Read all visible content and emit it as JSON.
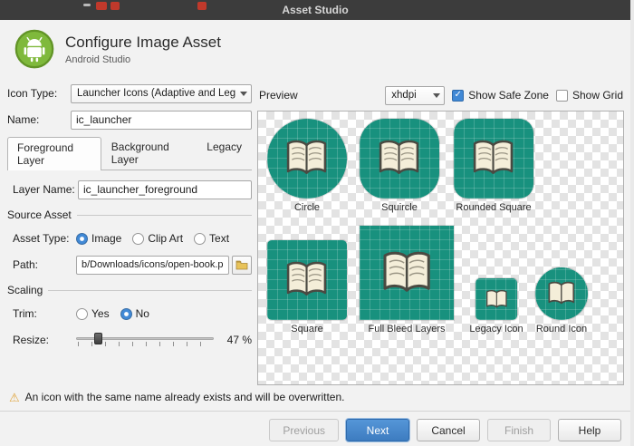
{
  "titlebar": {
    "title": "Asset Studio"
  },
  "header": {
    "title": "Configure Image Asset",
    "subtitle": "Android Studio"
  },
  "form": {
    "icon_type_label": "Icon Type:",
    "icon_type_value": "Launcher Icons (Adaptive and Legacy)",
    "name_label": "Name:",
    "name_value": "ic_launcher",
    "tabs": [
      {
        "label": "Foreground Layer",
        "selected": true
      },
      {
        "label": "Background Layer",
        "selected": false
      },
      {
        "label": "Legacy",
        "selected": false
      }
    ],
    "layer_name_label": "Layer Name:",
    "layer_name_value": "ic_launcher_foreground",
    "source_asset_section": "Source Asset",
    "asset_type_label": "Asset Type:",
    "asset_type_options": [
      "Image",
      "Clip Art",
      "Text"
    ],
    "asset_type_selected": "Image",
    "path_label": "Path:",
    "path_value": "b/Downloads/icons/open-book.png",
    "scaling_section": "Scaling",
    "trim_label": "Trim:",
    "trim_options": [
      "Yes",
      "No"
    ],
    "trim_selected": "No",
    "resize_label": "Resize:",
    "resize_value": "47 %"
  },
  "preview": {
    "label": "Preview",
    "density_value": "xhdpi",
    "safe_zone_label": "Show Safe Zone",
    "safe_zone_checked": true,
    "grid_label": "Show Grid",
    "grid_checked": false,
    "icons": [
      {
        "label": "Circle"
      },
      {
        "label": "Squircle"
      },
      {
        "label": "Rounded Square"
      },
      {
        "label": "Square"
      },
      {
        "label": "Full Bleed Layers"
      },
      {
        "label": "Legacy Icon"
      },
      {
        "label": "Round Icon"
      }
    ],
    "check_glyph": "✓"
  },
  "footer": {
    "warning_icon": "⚠",
    "warning": "An icon with the same name already exists and will be overwritten.",
    "buttons": [
      {
        "label": "Previous",
        "state": "disabled"
      },
      {
        "label": "Next",
        "state": "primary"
      },
      {
        "label": "Cancel",
        "state": "normal"
      },
      {
        "label": "Finish",
        "state": "disabled"
      },
      {
        "label": "Help",
        "state": "normal"
      }
    ]
  }
}
